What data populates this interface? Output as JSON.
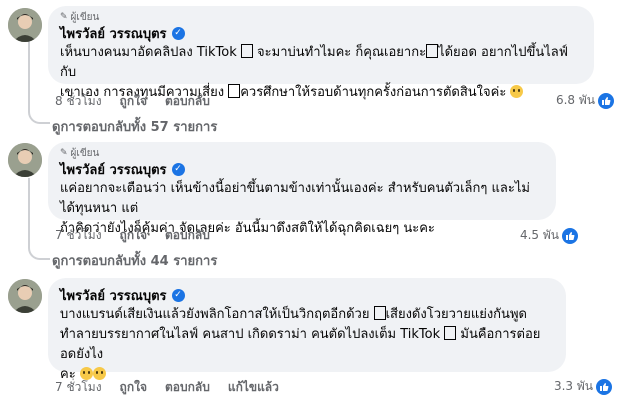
{
  "comments": [
    {
      "badge": "ผู้เขียน",
      "author": "ไพรวัลย์ วรรณบุตร",
      "lines": [
        [
          "เห็นบางคนมาอัดคลิปลง TikTok ",
          "box",
          " จะมาบ่นทำไมคะ ก็คุณเอยากะ",
          "box",
          "ได้ยอด อยากไปขึ้นไลฟ์กับ"
        ],
        [
          "เขาเอง การลงทุนมีความเสี่ยง ",
          "box",
          "ควรศึกษาให้รอบด้านทุกครั้งก่อนการตัดสินใจค่ะ ",
          "emoji"
        ]
      ],
      "time": "8 ชั่วโมง",
      "like": "ถูกใจ",
      "reply": "ตอบกลับ",
      "likes": "6.8 พัน",
      "view_replies": "ดูการตอบกลับทั้ง 57 รายการ"
    },
    {
      "badge": "ผู้เขียน",
      "author": "ไพรวัลย์ วรรณบุตร",
      "lines": [
        [
          "แค่อยากจะเตือนว่า เห็นข้างนี้อย่าขึ้นตามข้างเท่านั้นเองค่ะ สำหรับคนตัวเล็กๆ และไม่ได้ทุนหนา แต่"
        ],
        [
          "ถ้าคิดว่ายังไงก็คุ้มค่า จัดเลยค่ะ อันนี้มาดึงสติให้ได้ฉุกคิดเฉยๆ นะคะ"
        ]
      ],
      "time": "7 ชั่วโมง",
      "like": "ถูกใจ",
      "reply": "ตอบกลับ",
      "likes": "4.5 พัน",
      "view_replies": "ดูการตอบกลับทั้ง 44 รายการ"
    },
    {
      "author": "ไพรวัลย์ วรรณบุตร",
      "lines": [
        [
          "บางแบรนด์เสียเงินแล้วยังพลิกโอกาสให้เป็นวิกฤตอีกด้วย ",
          "box",
          "เสียงดังโวยวายแย่งกันพูด"
        ],
        [
          "ทำลายบรรยากาศในไลฟ์ คนสาป เกิดดราม่า คนตัดไปลงเต็ม TikTok ",
          "box",
          " มันคือการต่อยอดยังไง"
        ],
        [
          "คะ ",
          "emoji",
          "emoji"
        ]
      ],
      "time": "7 ชั่วโมง",
      "like": "ถูกใจ",
      "reply": "ตอบกลับ",
      "edited": "แก้ไขแล้ว",
      "likes": "3.3 พัน"
    }
  ],
  "icons": {
    "author_badge": "pencil-icon",
    "verified": "verified-check-icon",
    "like": "thumbs-up-icon"
  },
  "colors": {
    "bubble": "#f0f2f5",
    "accent": "#1b74e4",
    "muted": "#65676b"
  }
}
